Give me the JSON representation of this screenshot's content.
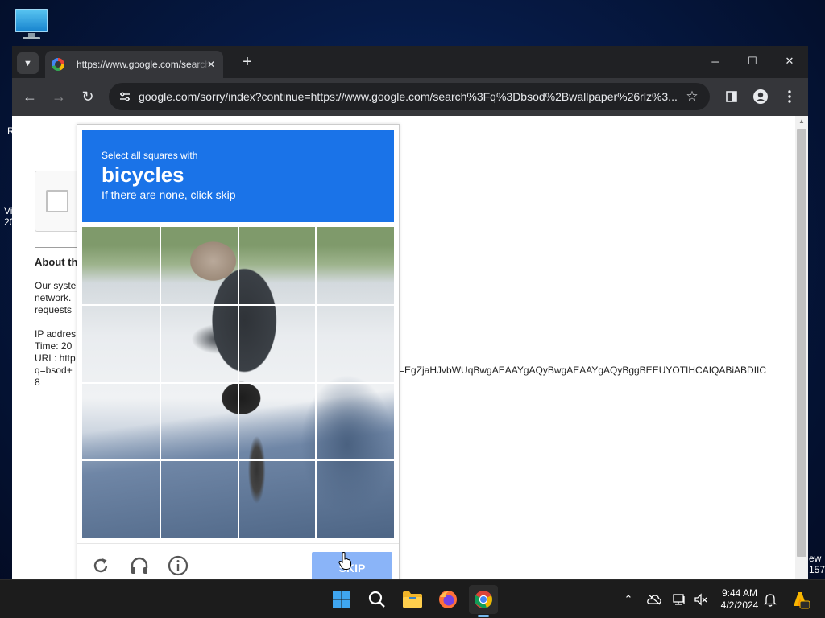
{
  "browser": {
    "tab_title": "https://www.google.com/search",
    "new_tab_label": "+",
    "url": "google.com/sorry/index?continue=https://www.google.com/search%3Fq%3Dbsod%2Bwallpaper%26rlz%3...",
    "window_controls": {
      "minimize": "─",
      "maximize": "☐",
      "close": "✕"
    }
  },
  "desktop": {
    "left_fragments": [
      "R",
      "Vi",
      "20"
    ],
    "right_fragments": [
      "ew",
      "157"
    ]
  },
  "page": {
    "heading_fragment": "About th",
    "body_lines": [
      "Our syste",
      "network.",
      "requests"
    ],
    "ip_line": "IP addres",
    "time_line": "Time: 20",
    "url_line": "URL: http",
    "query_line": "q=bsod+",
    "trailing_char": "8",
    "long_url_tail": "=EgZjaHJvbWUqBwgAEAAYgAQyBwgAEAAYgAQyBggBEEUYOTIHCAIQABiABDIIC"
  },
  "captcha": {
    "instruction": "Select all squares with",
    "target": "bicycles",
    "hint": "If there are none, click skip",
    "skip_label": "SKIP",
    "grid": {
      "rows": 4,
      "cols": 4
    },
    "header_color": "#1a73e8"
  },
  "taskbar": {
    "time": "9:44 AM",
    "date": "4/2/2024",
    "accent_color": "#76b9ed"
  }
}
